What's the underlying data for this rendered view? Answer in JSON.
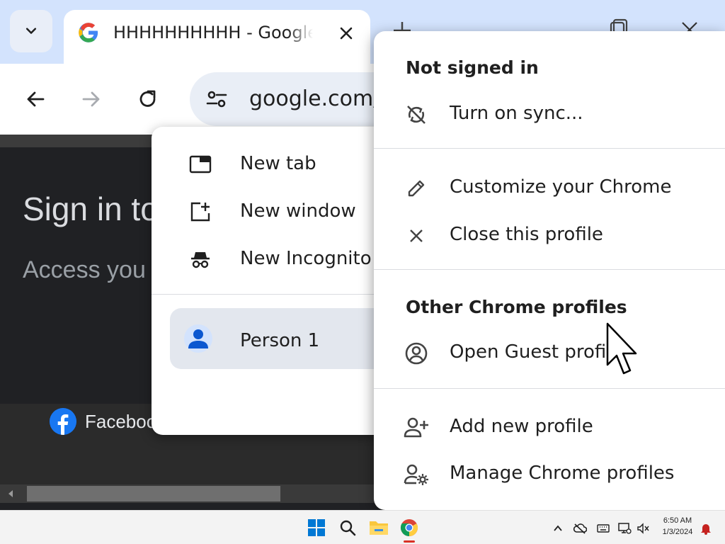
{
  "browser": {
    "tab": {
      "title": "HHHHHHHHHH - Google",
      "favicon": "google-g-icon"
    },
    "url": "google.com/",
    "colors": {
      "tabstrip": "#d3e3fd",
      "toolbar": "#ffffff",
      "omnibox": "#e9eef6"
    }
  },
  "page": {
    "title": "Sign in to",
    "subtitle": "Access you",
    "footer_link": "Facebook",
    "background": "#202124"
  },
  "app_menu": {
    "items": [
      {
        "label": "New tab",
        "icon": "new-tab-icon"
      },
      {
        "label": "New window",
        "icon": "new-window-icon"
      },
      {
        "label": "New Incognito window",
        "icon": "incognito-icon"
      }
    ],
    "profile": {
      "label": "Person 1",
      "icon": "person-icon"
    }
  },
  "profile_menu": {
    "heading_signed": "Not signed in",
    "sync_label": "Turn on sync...",
    "customize_label": "Customize your Chrome",
    "close_profile_label": "Close this profile",
    "other_heading": "Other Chrome profiles",
    "guest_label": "Open Guest profile",
    "add_profile_label": "Add new profile",
    "manage_label": "Manage Chrome profiles"
  },
  "taskbar": {
    "time": "6:50 AM",
    "date": "1/3/2024",
    "apps": [
      "windows-start-icon",
      "search-icon",
      "file-explorer-icon",
      "chrome-icon"
    ],
    "tray": [
      "chevron-up-icon",
      "onedrive-icon",
      "keyboard-icon",
      "network-icon",
      "volume-mute-icon",
      "notification-bell-icon"
    ]
  }
}
